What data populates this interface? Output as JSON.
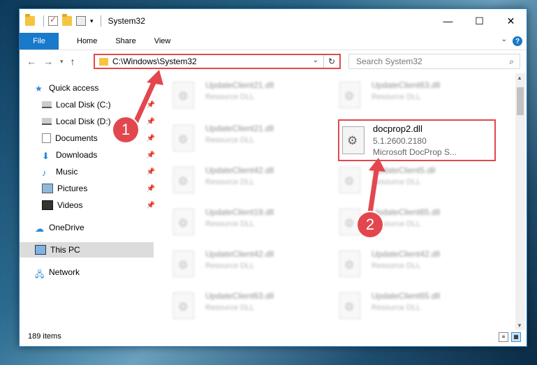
{
  "window": {
    "title": "System32",
    "controls": {
      "minimize": "—",
      "maximize": "☐",
      "close": "✕"
    }
  },
  "ribbon": {
    "tabs": [
      "File",
      "Home",
      "Share",
      "View"
    ],
    "help": "?"
  },
  "address": {
    "path": "C:\\Windows\\System32",
    "refresh_icon": "refresh-icon"
  },
  "search": {
    "placeholder": "Search System32"
  },
  "sidebar": {
    "items": [
      {
        "label": "Quick access",
        "icon": "star-icon"
      },
      {
        "label": "Local Disk (C:)",
        "icon": "drive-icon",
        "pinned": true
      },
      {
        "label": "Local Disk (D:)",
        "icon": "drive-icon",
        "pinned": true
      },
      {
        "label": "Documents",
        "icon": "documents-icon",
        "pinned": true
      },
      {
        "label": "Downloads",
        "icon": "download-icon",
        "pinned": true
      },
      {
        "label": "Music",
        "icon": "music-icon",
        "pinned": true
      },
      {
        "label": "Pictures",
        "icon": "pictures-icon",
        "pinned": true
      },
      {
        "label": "Videos",
        "icon": "videos-icon",
        "pinned": true
      },
      {
        "label": "OneDrive",
        "icon": "cloud-icon"
      },
      {
        "label": "This PC",
        "icon": "computer-icon",
        "selected": true
      },
      {
        "label": "Network",
        "icon": "network-icon"
      }
    ]
  },
  "files": {
    "left": [
      {
        "name": "UpdateClient21.dll",
        "desc": "Resource DLL"
      },
      {
        "name": "UpdateClient21.dll",
        "desc": "Resource DLL"
      },
      {
        "name": "UpdateClient42.dll",
        "desc": "Resource DLL"
      },
      {
        "name": "UpdateClient19.dll",
        "desc": "Resource DLL"
      },
      {
        "name": "UpdateClient42.dll",
        "desc": "Resource DLL"
      },
      {
        "name": "UpdateClient63.dll",
        "desc": "Resource DLL"
      }
    ],
    "right": [
      {
        "name": "UpdateClient63.dll",
        "desc": "Resource DLL"
      },
      {
        "name": "UpdateClient5.dll",
        "desc": "Resource DLL"
      },
      {
        "name": "UpdateClient65.dll",
        "desc": "Resource DLL"
      },
      {
        "name": "UpdateClient42.dll",
        "desc": "Resource DLL"
      },
      {
        "name": "UpdateClient65.dll",
        "desc": "Resource DLL"
      }
    ],
    "highlighted": {
      "name": "docprop2.dll",
      "version": "5.1.2600.2180",
      "description": "Microsoft DocProp S..."
    }
  },
  "status": {
    "count": "189 items"
  },
  "markers": {
    "one": "1",
    "two": "2"
  },
  "colors": {
    "accent": "#1979ca",
    "highlight": "#e3474e"
  }
}
